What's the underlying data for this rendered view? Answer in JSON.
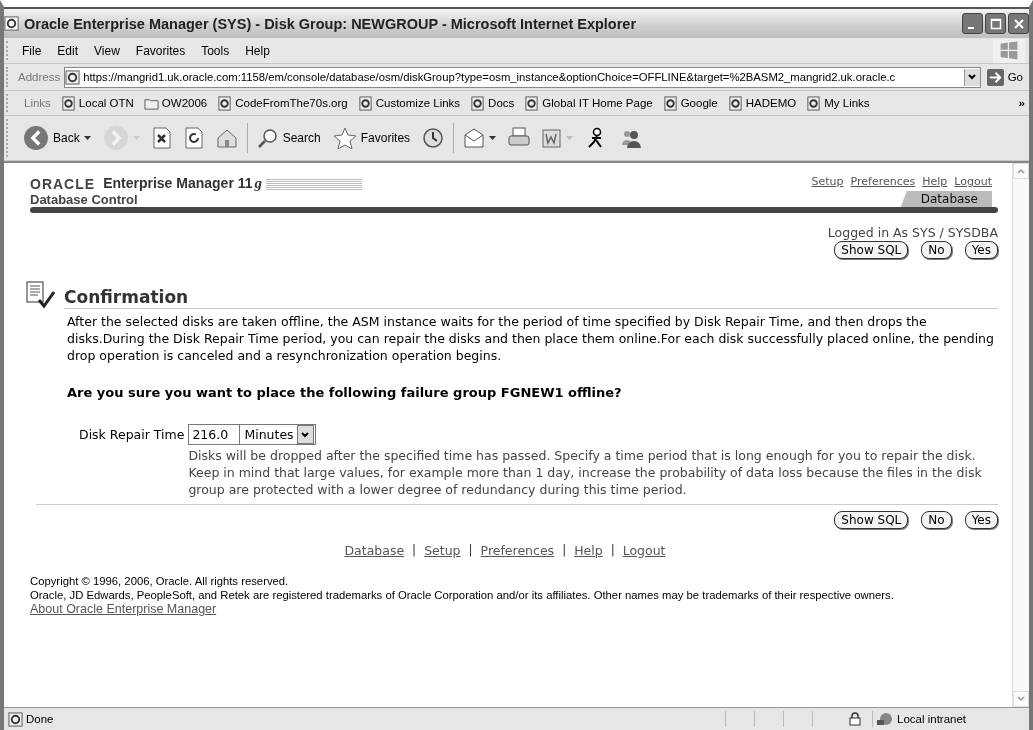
{
  "window": {
    "title": "Oracle Enterprise Manager (SYS) - Disk Group: NEWGROUP - Microsoft Internet Explorer"
  },
  "menu": [
    "File",
    "Edit",
    "View",
    "Favorites",
    "Tools",
    "Help"
  ],
  "address": {
    "label": "Address",
    "url": "https://mangrid1.uk.oracle.com:1158/em/console/database/osm/diskGroup?type=osm_instance&optionChoice=OFFLINE&target=%2BASM2_mangrid2.uk.oracle.c",
    "go": "Go"
  },
  "links_bar": {
    "label": "Links",
    "more": "»",
    "items": [
      {
        "label": "Local OTN",
        "kind": "page"
      },
      {
        "label": "OW2006",
        "kind": "folder"
      },
      {
        "label": "CodeFromThe70s.org",
        "kind": "page"
      },
      {
        "label": "Customize Links",
        "kind": "page"
      },
      {
        "label": "Docs",
        "kind": "page"
      },
      {
        "label": "Global IT Home Page",
        "kind": "page"
      },
      {
        "label": "Google",
        "kind": "page"
      },
      {
        "label": "HADEMO",
        "kind": "page"
      },
      {
        "label": "My Links",
        "kind": "page"
      }
    ]
  },
  "toolbar": [
    {
      "kind": "back",
      "label": "Back",
      "disabled": false
    },
    {
      "kind": "forward",
      "disabled": true
    },
    {
      "kind": "stop",
      "disabled": false
    },
    {
      "kind": "refresh",
      "disabled": false
    },
    {
      "kind": "home",
      "disabled": false
    },
    {
      "kind": "search",
      "label": "Search",
      "disabled": false
    },
    {
      "kind": "favorites",
      "label": "Favorites",
      "disabled": false
    },
    {
      "kind": "history",
      "disabled": false
    },
    {
      "kind": "mail",
      "disabled": false
    },
    {
      "kind": "print",
      "disabled": false
    },
    {
      "kind": "edit",
      "disabled": false
    },
    {
      "kind": "messenger",
      "disabled": false
    },
    {
      "kind": "contacts",
      "disabled": false
    }
  ],
  "header": {
    "logo": "ORACLE",
    "product": "Enterprise Manager 11",
    "product_suffix": "g",
    "subtitle": "Database Control",
    "global_links": [
      "Setup",
      "Preferences",
      "Help",
      "Logout"
    ],
    "tabs": [
      {
        "label": "Database",
        "selected": true
      }
    ]
  },
  "logged_in": "Logged in As SYS / SYSDBA",
  "top_buttons": [
    "Show SQL",
    "No",
    "Yes"
  ],
  "heading": "Confirmation",
  "message": "After the selected disks are taken offline, the ASM instance waits for the period of time specified by Disk Repair Time, and then drops the disks.During the Disk Repair Time period, you can repair the disks and then place them online.For each disk successfully placed online, the pending drop operation is canceled and a resynchronization operation begins.",
  "question": "Are you sure you want to place the following failure group FGNEW1 offline?",
  "repair_time": {
    "label": "Disk Repair Time",
    "value": "216.0",
    "unit": "Minutes",
    "help": "Disks will be dropped after the specified time has passed. Specify a time period that is long enough for you to repair the disk. Keep in mind that large values, for example more than 1 day, increase the probability of data loss because the files in the disk group are protected with a lower degree of redundancy during this time period."
  },
  "bottom_buttons": [
    "Show SQL",
    "No",
    "Yes"
  ],
  "footer_links": [
    "Database",
    "Setup",
    "Preferences",
    "Help",
    "Logout"
  ],
  "footer_separator": "|",
  "copyright": "Copyright © 1996, 2006, Oracle. All rights reserved.",
  "trademarks": "Oracle, JD Edwards, PeopleSoft, and Retek are registered trademarks of Oracle Corporation and/or its affiliates. Other names may be trademarks of their respective owners.",
  "about_link": "About Oracle Enterprise Manager",
  "status_bar": {
    "text": "Done",
    "zone": "Local intranet"
  }
}
